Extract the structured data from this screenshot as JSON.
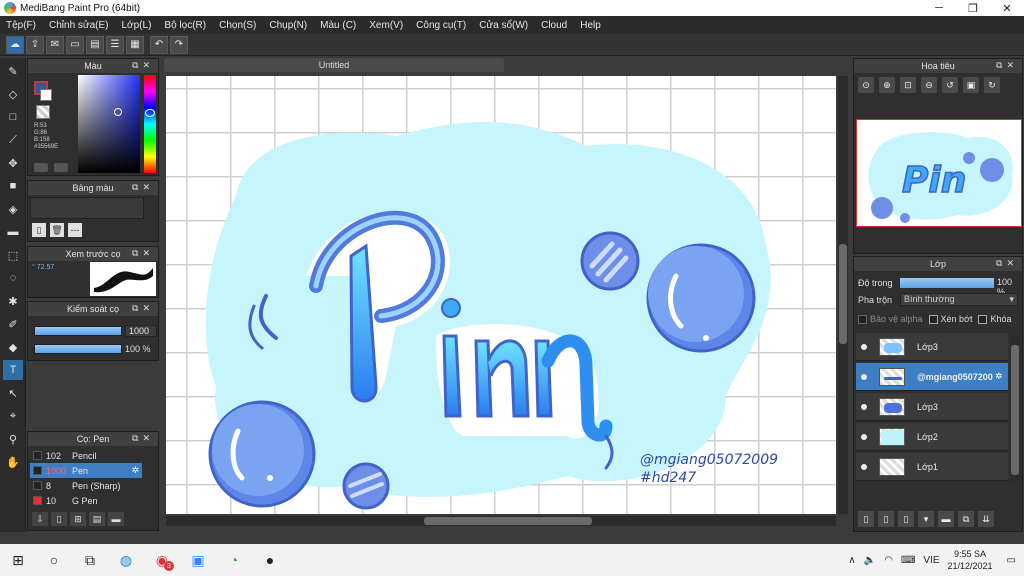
{
  "window": {
    "title": "MediBang Paint Pro (64bit)",
    "minimize_icon": "─",
    "maximize_icon": "❐",
    "close_icon": "✕"
  },
  "menu": [
    "Tệp(F)",
    "Chỉnh sửa(E)",
    "Lớp(L)",
    "Bộ lọc(R)",
    "Chọn(S)",
    "Chụp(N)",
    "Màu (C)",
    "Xem(V)",
    "Công cụ(T)",
    "Cửa sổ(W)",
    "Cloud",
    "Help"
  ],
  "color_panel": {
    "title": "Màu",
    "r": "R:53",
    "g": "G:86",
    "b": "B:158",
    "hex": "#35569E"
  },
  "palette_panel": {
    "title": "Bảng màu",
    "empty_text": "---"
  },
  "brush_preview": {
    "title": "Xem trước cọ",
    "size": "72.57"
  },
  "brush_control": {
    "title": "Kiểm soát cọ",
    "size_value": "1000",
    "opacity_value": "100 %"
  },
  "brush_list": {
    "title": "Cọ: Pen",
    "items": [
      {
        "num": "102",
        "name": "Pencil",
        "selected": false
      },
      {
        "num": "1000",
        "name": "Pen",
        "selected": true
      },
      {
        "num": "8",
        "name": "Pen (Sharp)",
        "selected": false
      },
      {
        "num": "10",
        "name": "G Pen",
        "selected": false
      }
    ]
  },
  "canvas": {
    "tab_title": "Untitled",
    "art_text": "Pin",
    "credit_line1": "@mgiang05072009",
    "credit_line2": "#hd247"
  },
  "navigator": {
    "title": "Hoa tiêu",
    "thumb_text": "Pin"
  },
  "layer_panel": {
    "title": "Lớp",
    "opacity_label": "Độ trong",
    "opacity_value": "100 %",
    "blend_label": "Pha trộn",
    "blend_value": "Bình thường",
    "protect_alpha": "Bảo vệ alpha",
    "clipping": "Xén bớt",
    "lock": "Khóa",
    "layers": [
      {
        "name": "Lớp3",
        "selected": false
      },
      {
        "name": "@mgiang0507200",
        "selected": true
      },
      {
        "name": "Lớp3",
        "selected": false
      },
      {
        "name": "Lớp2",
        "selected": false
      },
      {
        "name": "Lớp1",
        "selected": false
      }
    ]
  },
  "taskbar": {
    "lang": "VIE",
    "time": "9:55 SA",
    "date": "21/12/2021",
    "badge": "3"
  },
  "colors": {
    "selected_blue": "#3e7fc4",
    "current_color": "#35569e",
    "bg_cyan": "#c6f5fb"
  }
}
